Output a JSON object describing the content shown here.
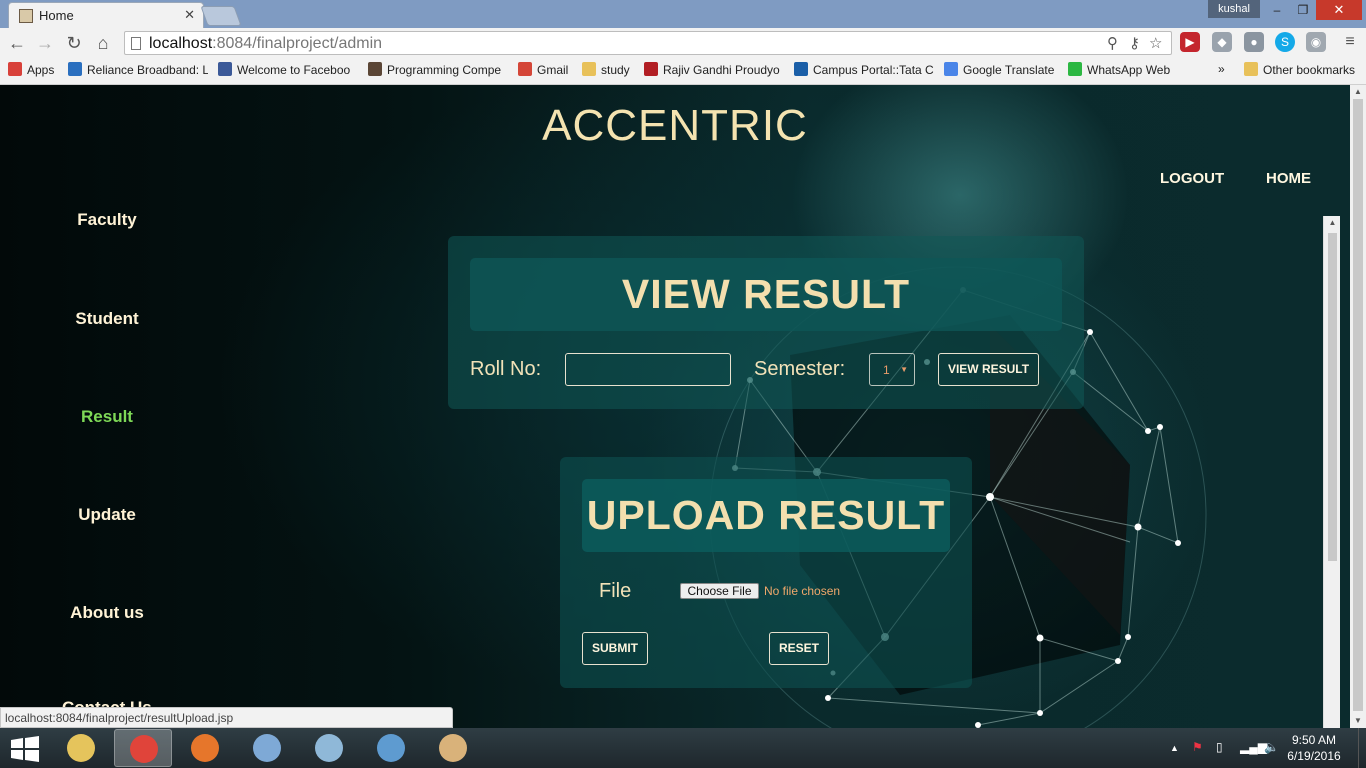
{
  "browser": {
    "tab_title": "Home",
    "user_name": "kushal",
    "url_host": "localhost",
    "url_path": ":8084/finalproject/admin",
    "window_controls": {
      "minimize": "–",
      "maximize": "❐",
      "close": "✕"
    }
  },
  "bookmarks": {
    "items": [
      {
        "label": "Apps",
        "icon": "apps-grid-icon",
        "color": "#d8413a"
      },
      {
        "label": "Reliance Broadband: L",
        "icon": "reliance-logo-icon",
        "color": "#2a6fbf"
      },
      {
        "label": "Welcome to Faceboo",
        "icon": "facebook-icon",
        "color": "#3b5998"
      },
      {
        "label": "Programming Compe",
        "icon": "codechef-icon",
        "color": "#5b4636"
      },
      {
        "label": "Gmail",
        "icon": "gmail-icon",
        "color": "#d44638"
      },
      {
        "label": "study",
        "icon": "folder-icon",
        "color": "#e8c15a"
      },
      {
        "label": "Rajiv Gandhi Proudyo",
        "icon": "rgpv-logo-icon",
        "color": "#b21e24"
      },
      {
        "label": "Campus Portal::Tata C",
        "icon": "tata-logo-icon",
        "color": "#1b5fa8"
      },
      {
        "label": "Google Translate",
        "icon": "google-translate-icon",
        "color": "#4a85e8"
      },
      {
        "label": "WhatsApp Web",
        "icon": "whatsapp-icon",
        "color": "#2cb742"
      }
    ],
    "overflow": "»",
    "other": "Other bookmarks"
  },
  "site": {
    "title": "ACCENTRIC",
    "top_nav": [
      "LOGOUT",
      "HOME"
    ],
    "sidebar": [
      {
        "label": "Faculty",
        "active": false
      },
      {
        "label": "Student",
        "active": false
      },
      {
        "label": "Result",
        "active": true
      },
      {
        "label": "Update",
        "active": false
      },
      {
        "label": "About us",
        "active": false
      }
    ],
    "partial_link": "Contact Us"
  },
  "view_result": {
    "heading": "VIEW RESULT",
    "roll_label": "Roll No:",
    "roll_value": "",
    "semester_label": "Semester:",
    "semester_value": "1",
    "button": "VIEW RESULT"
  },
  "upload_result": {
    "heading": "UPLOAD RESULT",
    "file_label": "File",
    "file_button": "Choose File",
    "file_status": "No file chosen",
    "submit": "SUBMIT",
    "reset": "RESET"
  },
  "status_bar": "localhost:8084/finalproject/resultUpload.jsp",
  "taskbar": {
    "apps": [
      {
        "name": "file-explorer-icon",
        "active": false,
        "color": "#e5c45c"
      },
      {
        "name": "chrome-icon",
        "active": true,
        "color": "#e0443a"
      },
      {
        "name": "firefox-icon",
        "active": false,
        "color": "#e6762b"
      },
      {
        "name": "virtualbox-icon",
        "active": false,
        "color": "#7ea9d6"
      },
      {
        "name": "notepad-icon",
        "active": false,
        "color": "#8fb8d8"
      },
      {
        "name": "remote-desktop-icon",
        "active": false,
        "color": "#5e9bd0"
      },
      {
        "name": "paint-icon",
        "active": false,
        "color": "#d9b27a"
      }
    ],
    "clock_time": "9:50 AM",
    "clock_date": "6/19/2016"
  },
  "colors": {
    "title_gold": "#f4e3b0",
    "active_link": "#7ed957",
    "panel_teal": "#106a68"
  }
}
